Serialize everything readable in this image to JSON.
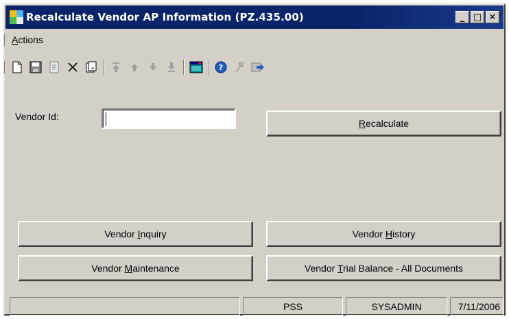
{
  "window": {
    "title": "Recalculate Vendor AP Information (PZ.435.00)",
    "controls": {
      "minimize": "_",
      "maximize": "□",
      "close": "✕"
    }
  },
  "menu": {
    "items": [
      {
        "label": "Actions",
        "mnemonic": "A"
      }
    ]
  },
  "toolbar": {
    "icons": [
      "new-icon",
      "save-icon",
      "finish-icon",
      "delete-icon",
      "cancel-icon",
      "first-icon",
      "previous-icon",
      "next-icon",
      "last-icon",
      "template-icon",
      "help-icon",
      "customize-icon",
      "navigate-icon"
    ]
  },
  "form": {
    "vendor_id_label": "Vendor Id:",
    "vendor_id_value": "",
    "recalculate_button": {
      "label": "Recalculate",
      "mnemonic": "R"
    }
  },
  "actions": {
    "vendor_inquiry": {
      "before": "Vendor ",
      "mnemonic": "I",
      "after": "nquiry"
    },
    "vendor_history": {
      "before": "Vendor ",
      "mnemonic": "H",
      "after": "istory"
    },
    "vendor_maintenance": {
      "before": "Vendor ",
      "mnemonic": "M",
      "after": "aintenance"
    },
    "vendor_trial_balance": {
      "before": "Vendor ",
      "mnemonic": "T",
      "after": "rial Balance - All Documents"
    }
  },
  "status": {
    "message": "",
    "company": "PSS",
    "user": "SYSADMIN",
    "date": "7/11/2006"
  },
  "colors": {
    "titlebar": "#0a246a",
    "face": "#d4d0c8"
  }
}
